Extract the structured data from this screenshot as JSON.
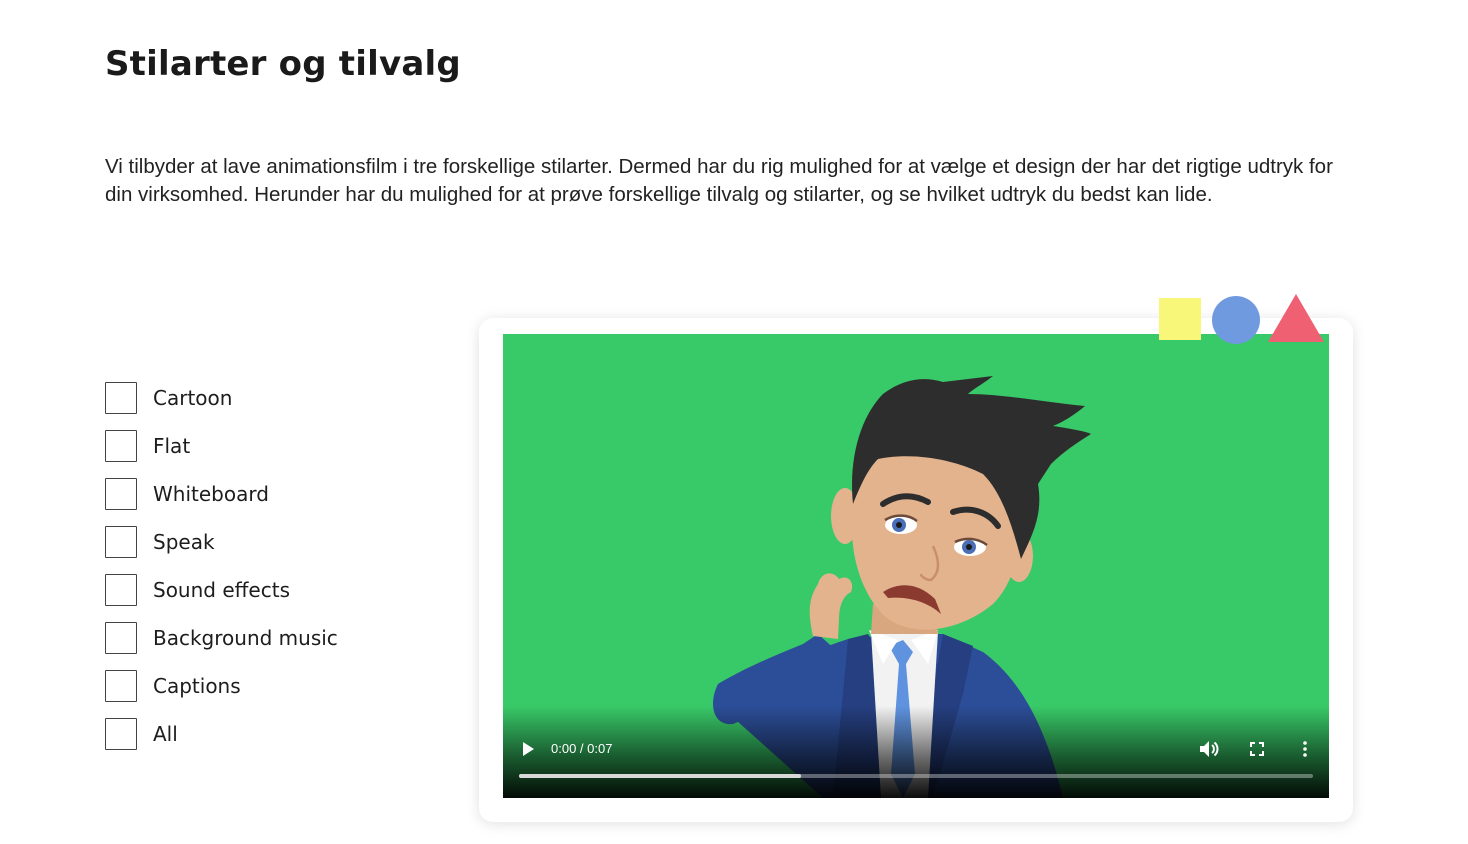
{
  "page": {
    "title": "Stilarter og tilvalg",
    "intro": "Vi tilbyder at lave animationsfilm i tre forskellige stilarter. Dermed har du rig mulighed for at vælge et design der har det rigtige udtryk for din virksomhed. Herunder har du mulighed for at prøve forskellige tilvalg og stilarter, og se hvilket udtryk du bedst kan lide."
  },
  "options": [
    {
      "label": "Cartoon",
      "checked": false
    },
    {
      "label": "Flat",
      "checked": false
    },
    {
      "label": "Whiteboard",
      "checked": false
    },
    {
      "label": "Speak",
      "checked": false
    },
    {
      "label": "Sound effects",
      "checked": false
    },
    {
      "label": "Background music",
      "checked": false
    },
    {
      "label": "Captions",
      "checked": false
    },
    {
      "label": "All",
      "checked": false
    }
  ],
  "decor": {
    "square_color": "#f9f77a",
    "circle_color": "#6f9ae0",
    "triangle_color": "#ee6072"
  },
  "video": {
    "background_color": "#38c968",
    "time_display": "0:00 / 0:07",
    "buffered_fraction": 0.355,
    "icons": [
      "play-icon",
      "volume-icon",
      "fullscreen-icon",
      "more-options-icon"
    ]
  }
}
